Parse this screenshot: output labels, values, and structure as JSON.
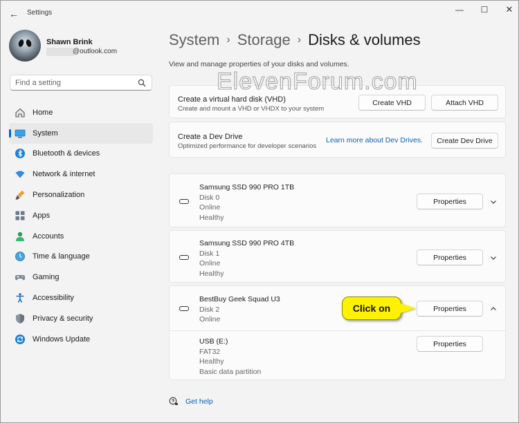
{
  "window": {
    "title": "Settings",
    "back_glyph": "←",
    "min_glyph": "—",
    "max_glyph": "☐",
    "close_glyph": "✕"
  },
  "user": {
    "name": "Shawn Brink",
    "email": "@outlook.com"
  },
  "search": {
    "placeholder": "Find a setting"
  },
  "nav": {
    "items": [
      {
        "label": "Home",
        "icon": "home-icon"
      },
      {
        "label": "System",
        "icon": "system-icon",
        "active": true
      },
      {
        "label": "Bluetooth & devices",
        "icon": "bluetooth-icon"
      },
      {
        "label": "Network & internet",
        "icon": "network-icon"
      },
      {
        "label": "Personalization",
        "icon": "brush-icon"
      },
      {
        "label": "Apps",
        "icon": "apps-icon"
      },
      {
        "label": "Accounts",
        "icon": "accounts-icon"
      },
      {
        "label": "Time & language",
        "icon": "globe-clock-icon"
      },
      {
        "label": "Gaming",
        "icon": "gamepad-icon"
      },
      {
        "label": "Accessibility",
        "icon": "accessibility-icon"
      },
      {
        "label": "Privacy & security",
        "icon": "shield-icon"
      },
      {
        "label": "Windows Update",
        "icon": "update-icon"
      }
    ]
  },
  "breadcrumb": {
    "items": [
      "System",
      "Storage",
      "Disks & volumes"
    ],
    "separator": "›"
  },
  "subtitle": "View and manage properties of your disks and volumes.",
  "watermark": "ElevenForum.com",
  "vhd": {
    "title": "Create a virtual hard disk (VHD)",
    "desc": "Create and mount a VHD or VHDX to your system",
    "create_label": "Create VHD",
    "attach_label": "Attach VHD"
  },
  "devdrive": {
    "title": "Create a Dev Drive",
    "desc": "Optimized performance for developer scenarios",
    "link_label": "Learn more about Dev Drives.",
    "create_label": "Create Dev Drive"
  },
  "disks": [
    {
      "name": "Samsung SSD 990 PRO 1TB",
      "lines": [
        "Disk 0",
        "Online",
        "Healthy"
      ],
      "button": "Properties",
      "expanded": false
    },
    {
      "name": "Samsung SSD 990 PRO 4TB",
      "lines": [
        "Disk 1",
        "Online",
        "Healthy"
      ],
      "button": "Properties",
      "expanded": false
    },
    {
      "name": "BestBuy Geek Squad U3",
      "lines": [
        "Disk 2",
        "Online"
      ],
      "button": "Properties",
      "expanded": true,
      "volumes": [
        {
          "name": "USB (E:)",
          "lines": [
            "FAT32",
            "Healthy",
            "Basic data partition"
          ],
          "button": "Properties"
        }
      ]
    }
  ],
  "callout": {
    "text": "Click on",
    "color": "#fff200"
  },
  "help": {
    "label": "Get help"
  },
  "colors": {
    "accent": "#0067c0",
    "link": "#0a5fb4",
    "background": "#f3f3f3",
    "card": "#fbfbfb"
  }
}
